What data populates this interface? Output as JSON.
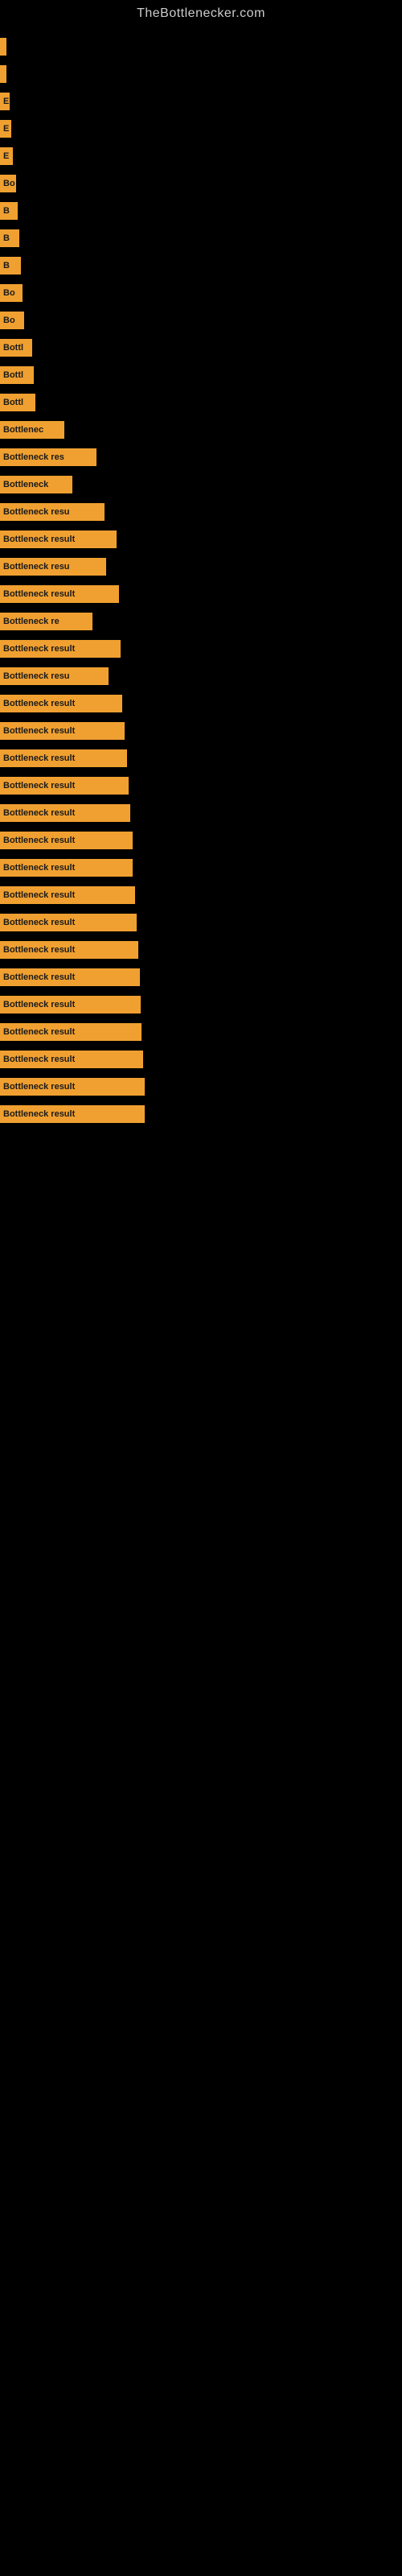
{
  "site": {
    "title": "TheBottlenecker.com"
  },
  "bars": [
    {
      "label": "",
      "width": 8
    },
    {
      "label": "",
      "width": 8
    },
    {
      "label": "E",
      "width": 12
    },
    {
      "label": "E",
      "width": 14
    },
    {
      "label": "E",
      "width": 16
    },
    {
      "label": "Bo",
      "width": 20
    },
    {
      "label": "B",
      "width": 22
    },
    {
      "label": "B",
      "width": 24
    },
    {
      "label": "B",
      "width": 26
    },
    {
      "label": "Bo",
      "width": 28
    },
    {
      "label": "Bo",
      "width": 30
    },
    {
      "label": "Bottl",
      "width": 40
    },
    {
      "label": "Bottl",
      "width": 42
    },
    {
      "label": "Bottl",
      "width": 44
    },
    {
      "label": "Bottlenec",
      "width": 80
    },
    {
      "label": "Bottleneck res",
      "width": 120
    },
    {
      "label": "Bottleneck",
      "width": 90
    },
    {
      "label": "Bottleneck resu",
      "width": 130
    },
    {
      "label": "Bottleneck result",
      "width": 145
    },
    {
      "label": "Bottleneck resu",
      "width": 132
    },
    {
      "label": "Bottleneck result",
      "width": 148
    },
    {
      "label": "Bottleneck re",
      "width": 115
    },
    {
      "label": "Bottleneck result",
      "width": 150
    },
    {
      "label": "Bottleneck resu",
      "width": 135
    },
    {
      "label": "Bottleneck result",
      "width": 152
    },
    {
      "label": "Bottleneck result",
      "width": 155
    },
    {
      "label": "Bottleneck result",
      "width": 158
    },
    {
      "label": "Bottleneck result",
      "width": 160
    },
    {
      "label": "Bottleneck result",
      "width": 162
    },
    {
      "label": "Bottleneck result",
      "width": 165
    },
    {
      "label": "Bottleneck result",
      "width": 165
    },
    {
      "label": "Bottleneck result",
      "width": 168
    },
    {
      "label": "Bottleneck result",
      "width": 170
    },
    {
      "label": "Bottleneck result",
      "width": 172
    },
    {
      "label": "Bottleneck result",
      "width": 174
    },
    {
      "label": "Bottleneck result",
      "width": 175
    },
    {
      "label": "Bottleneck result",
      "width": 176
    },
    {
      "label": "Bottleneck result",
      "width": 178
    },
    {
      "label": "Bottleneck result",
      "width": 180
    },
    {
      "label": "Bottleneck result",
      "width": 180
    }
  ]
}
